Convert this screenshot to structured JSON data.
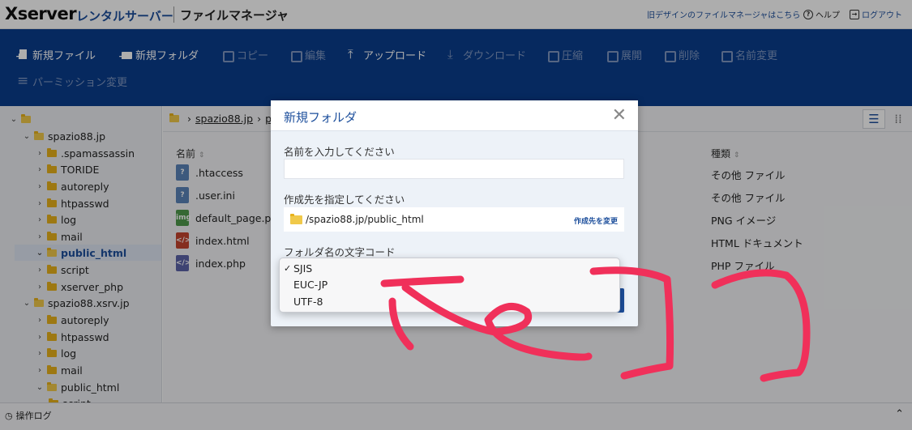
{
  "header": {
    "logo": "Xserver",
    "logo_sub": "レンタルサーバー",
    "app_title": "ファイルマネージャ",
    "old_design_link": "旧デザインのファイルマネージャはこちら",
    "help": "ヘルプ",
    "logout": "ログアウト"
  },
  "toolbar": {
    "new_file": "新規ファイル",
    "new_folder": "新規フォルダ",
    "copy": "コピー",
    "edit": "編集",
    "upload": "アップロード",
    "download": "ダウンロード",
    "compress": "圧縮",
    "extract": "展開",
    "delete": "削除",
    "rename": "名前変更",
    "permission": "パーミッション変更"
  },
  "tree": {
    "items": [
      {
        "label": ""
      },
      {
        "label": "spazio88.jp"
      },
      {
        "label": ".spamassassin"
      },
      {
        "label": "TORIDE"
      },
      {
        "label": "autoreply"
      },
      {
        "label": "htpasswd"
      },
      {
        "label": "log"
      },
      {
        "label": "mail"
      },
      {
        "label": "public_html"
      },
      {
        "label": "script"
      },
      {
        "label": "xserver_php"
      },
      {
        "label": "spazio88.xsrv.jp"
      },
      {
        "label": "autoreply"
      },
      {
        "label": "htpasswd"
      },
      {
        "label": "log"
      },
      {
        "label": "mail"
      },
      {
        "label": "public_html"
      },
      {
        "label": "script"
      }
    ]
  },
  "main": {
    "breadcrumb": {
      "part1": "spazio88.jp",
      "part2": "p"
    },
    "col_name": "名前",
    "col_type": "種類",
    "files": [
      {
        "name": ".htaccess",
        "type": "その他 ファイル",
        "icon": "?"
      },
      {
        "name": ".user.ini",
        "type": "その他 ファイル",
        "icon": "?"
      },
      {
        "name": "default_page.png",
        "type": "PNG イメージ",
        "icon": "img"
      },
      {
        "name": "index.html",
        "type": "HTML ドキュメント",
        "icon": "</>"
      },
      {
        "name": "index.php",
        "type": "PHP ファイル",
        "icon": "</>"
      }
    ]
  },
  "modal": {
    "title": "新規フォルダ",
    "name_label": "名前を入力してください",
    "name_value": "",
    "dest_label": "作成先を指定してください",
    "dest_path": "/spazio88.jp/public_html",
    "dest_change": "作成先を変更",
    "charset_label": "フォルダ名の文字コード"
  },
  "dropdown": {
    "options": [
      "SJIS",
      "EUC-JP",
      "UTF-8"
    ],
    "selected": "SJIS",
    "check": "✓"
  },
  "bottom": {
    "log_label": "操作ログ"
  },
  "colors": {
    "toolbar_bg": "#0a3d8c",
    "accent": "#1d4f9c",
    "annotation": "#f0305a",
    "folder": "#e8b21b"
  }
}
